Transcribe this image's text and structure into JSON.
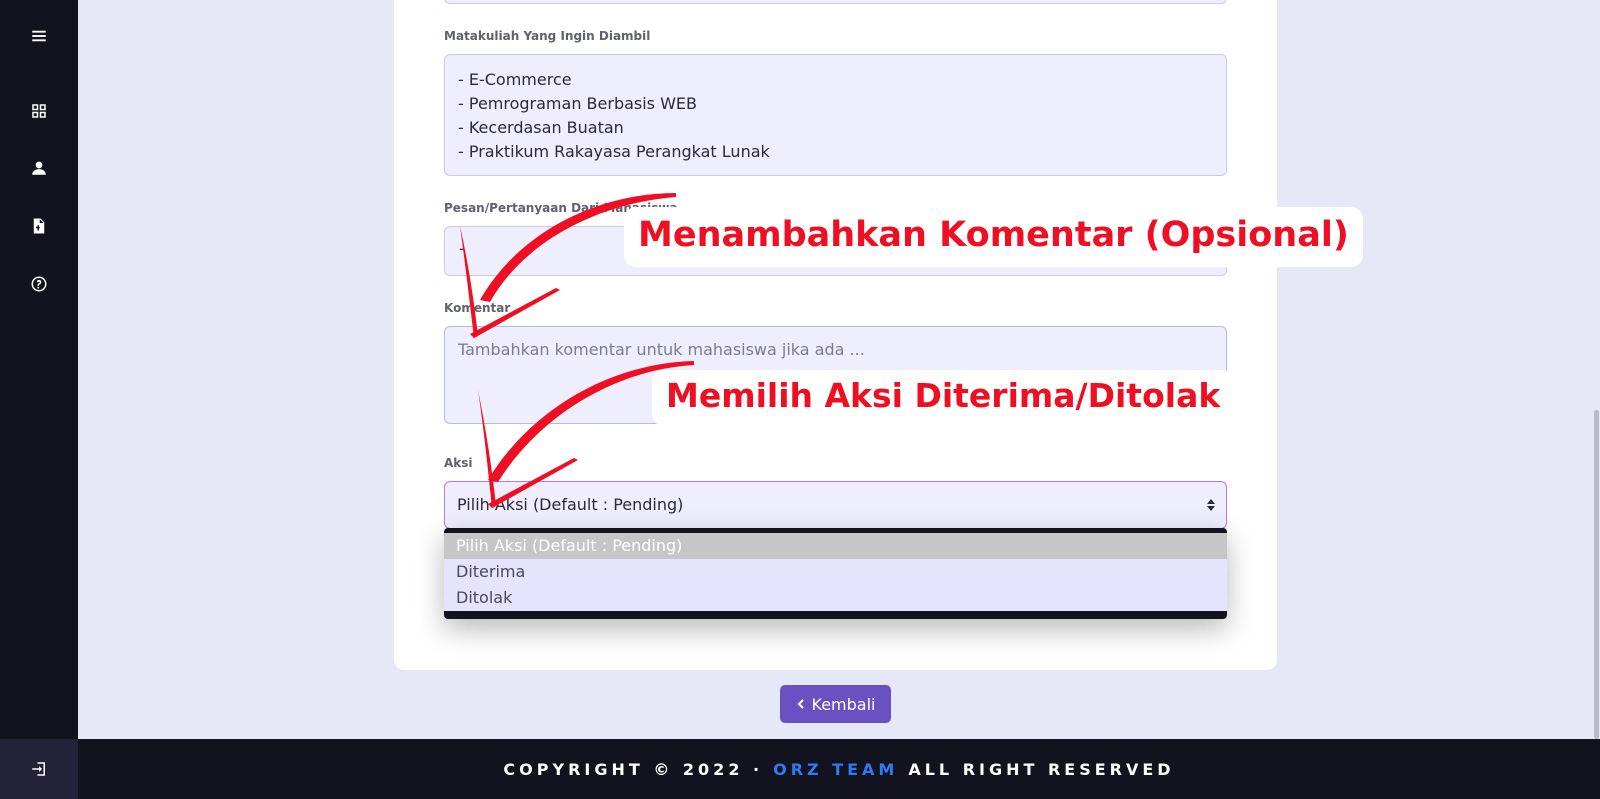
{
  "form": {
    "matakuliah_label": "Matakuliah Yang Ingin Diambil",
    "matakuliah_items": [
      "- E-Commerce",
      "- Pemrograman Berbasis WEB",
      "- Kecerdasan Buatan",
      "- Praktikum Rakayasa Perangkat Lunak"
    ],
    "pesan_label": "Pesan/Pertanyaan Dari Mahasiswa",
    "pesan_value": "-",
    "komentar_label": "Komentar",
    "komentar_placeholder": "Tambahkan komentar untuk mahasiswa jika ada ...",
    "aksi_label": "Aksi",
    "aksi_selected": "Pilih Aksi (Default : Pending)",
    "aksi_options": [
      "Pilih Aksi (Default : Pending)",
      "Diterima",
      "Ditolak"
    ]
  },
  "back_button": "Kembali",
  "footer": {
    "prefix": "COPYRIGHT © 2022 ·",
    "team": "ORZ TEAM",
    "suffix": "ALL RIGHT RESERVED"
  },
  "annotations": {
    "callout_komentar": "Menambahkan Komentar (Opsional)",
    "callout_aksi": "Memilih Aksi Diterima/Ditolak"
  },
  "sidebar_icons": [
    "menu-icon",
    "dashboard-icon",
    "user-icon",
    "file-icon",
    "help-icon",
    "logout-icon"
  ],
  "colors": {
    "sidebar": "#13121f",
    "accent": "#6a51c1",
    "annotation_red": "#ef0f22",
    "team_blue": "#2f7bf5"
  }
}
